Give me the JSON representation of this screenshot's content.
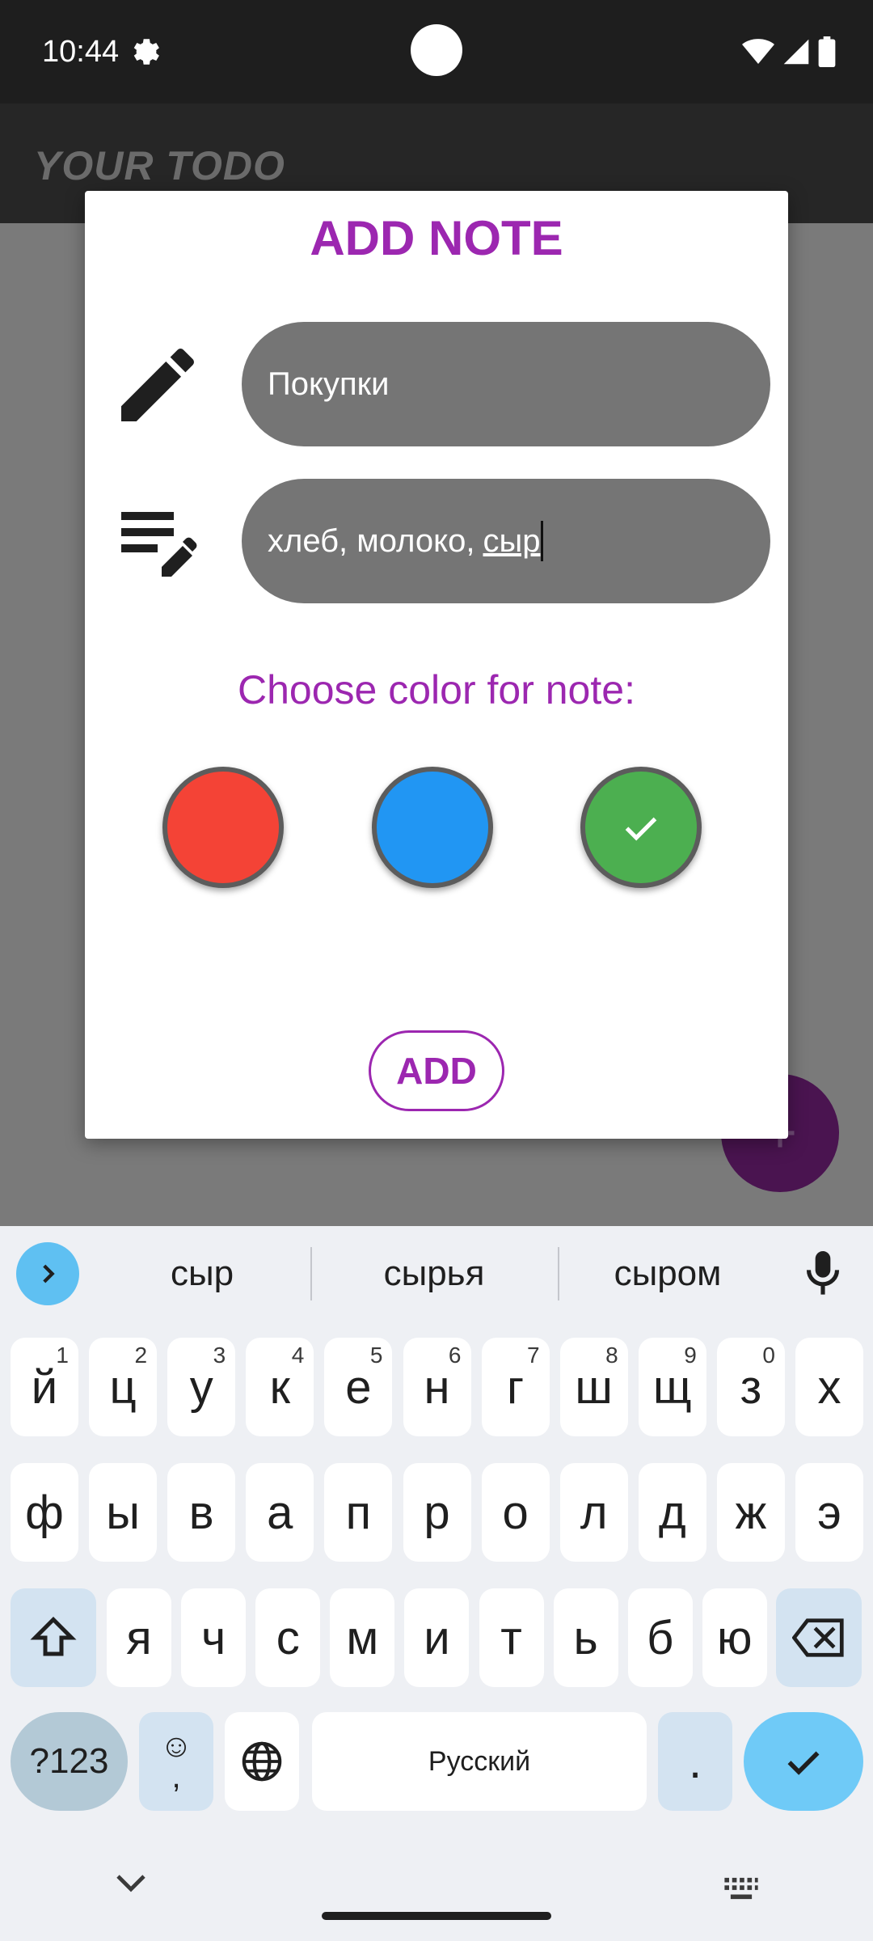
{
  "status_bar": {
    "time": "10:44",
    "icons": [
      "gear-icon",
      "wifi-icon",
      "signal-icon",
      "battery-icon"
    ]
  },
  "app_bar": {
    "title": "YOUR TODO"
  },
  "fab": {
    "icon": "plus-icon",
    "label": "+"
  },
  "dialog": {
    "title": "ADD NOTE",
    "title_field": {
      "icon": "pencil-icon",
      "value": "Покупки"
    },
    "description_field": {
      "icon": "edit-notes-icon",
      "value_plain": "хлеб, молоко,",
      "value_composing": "сыр"
    },
    "color_label": "Choose color for note:",
    "colors": [
      {
        "name": "red",
        "hex": "#f44336",
        "selected": false
      },
      {
        "name": "blue",
        "hex": "#2196f3",
        "selected": false
      },
      {
        "name": "green",
        "hex": "#4caf50",
        "selected": true
      }
    ],
    "add_button": "ADD",
    "accent_color": "#9c27b0"
  },
  "keyboard": {
    "suggestions": [
      "сыр",
      "сырья",
      "сыром"
    ],
    "row1": [
      {
        "label": "й",
        "hint": "1"
      },
      {
        "label": "ц",
        "hint": "2"
      },
      {
        "label": "у",
        "hint": "3"
      },
      {
        "label": "к",
        "hint": "4"
      },
      {
        "label": "е",
        "hint": "5"
      },
      {
        "label": "н",
        "hint": "6"
      },
      {
        "label": "г",
        "hint": "7"
      },
      {
        "label": "ш",
        "hint": "8"
      },
      {
        "label": "щ",
        "hint": "9"
      },
      {
        "label": "з",
        "hint": "0"
      },
      {
        "label": "х",
        "hint": ""
      }
    ],
    "row2": [
      "ф",
      "ы",
      "в",
      "а",
      "п",
      "р",
      "о",
      "л",
      "д",
      "ж",
      "э"
    ],
    "row3": [
      "я",
      "ч",
      "с",
      "м",
      "и",
      "т",
      "ь",
      "б",
      "ю"
    ],
    "symbols_label": "?123",
    "emoji_comma": ",",
    "space_label": "Русский",
    "period_label": "."
  }
}
